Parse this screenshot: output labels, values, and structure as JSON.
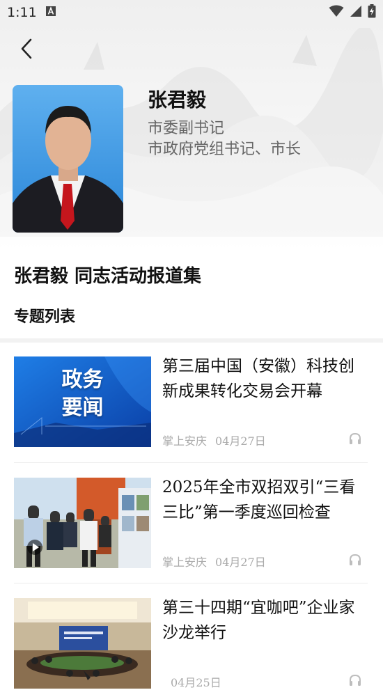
{
  "status_bar": {
    "time": "1:11",
    "notification_icon": "a-letter-icon",
    "wifi_icon": "wifi-icon",
    "signal_icon": "signal-icon",
    "battery_icon": "battery-charging-icon"
  },
  "nav": {
    "back_icon": "back-arrow-icon"
  },
  "profile": {
    "name": "张君毅",
    "titles": [
      "市委副书记",
      "市政府党组书记、市长"
    ]
  },
  "section": {
    "title": "张君毅 同志活动报道集",
    "list_title": "专题列表"
  },
  "news": [
    {
      "title": "第三届中国（安徽）科技创新成果转化交易会开幕",
      "source": "掌上安庆",
      "date": "04月27日",
      "thumb_text": [
        "政务",
        "要闻"
      ],
      "has_video": false
    },
    {
      "title": "2025年全市双招双引“三看三比”第一季度巡回检查",
      "source": "掌上安庆",
      "date": "04月27日",
      "thumb_text": [],
      "has_video": true
    },
    {
      "title": "第三十四期“宜咖吧”企业家沙龙举行",
      "source": "",
      "date": "04月25日",
      "thumb_text": [],
      "has_video": false
    }
  ],
  "colors": {
    "accent_blue": "#1565d8",
    "meta_gray": "#aaaaaa",
    "divider": "#f2f2f2"
  }
}
